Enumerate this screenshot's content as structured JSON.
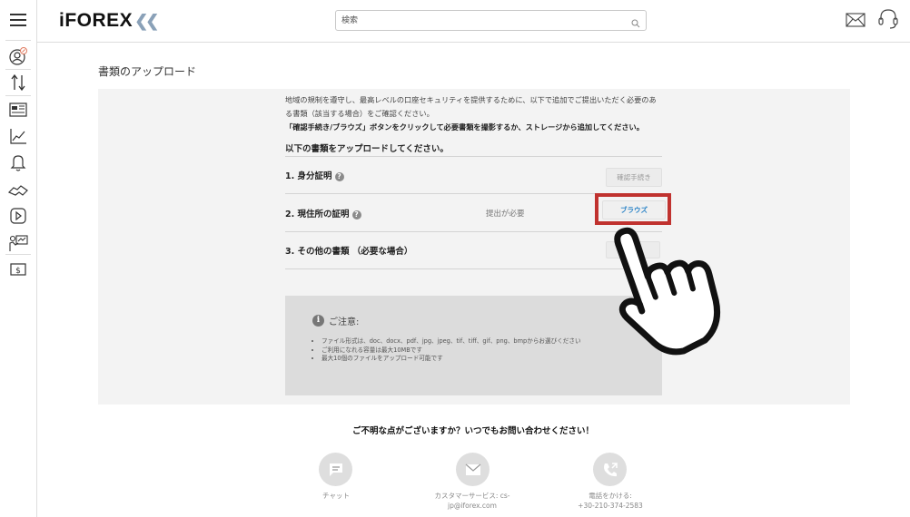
{
  "header": {
    "logo_text": "iFOREX",
    "logo_suffix": "❮❮",
    "search_placeholder": "検索"
  },
  "page": {
    "title": "書類のアップロード",
    "intro_line1": "地域の規制を遵守し、最高レベルの口座セキュリティを提供するために、以下で追加でご提出いただく必要のあ",
    "intro_line2": "る書類（該当する場合）をご確認ください。",
    "intro_line3": "「確認手続き/ブラウズ」ボタンをクリックして必要書類を撮影するか、ストレージから追加してください。",
    "upload_heading": "以下の書類をアップロードしてください。"
  },
  "documents": [
    {
      "label": "1.  身分証明",
      "status": "",
      "button": "確認手続き"
    },
    {
      "label": "2.  現住所の証明",
      "status": "提出が必要",
      "button": "ブラウズ"
    },
    {
      "label": "3.  その他の書類 （必要な場合）",
      "status": "",
      "button": "ブ"
    }
  ],
  "note": {
    "heading": "ご注意:",
    "items": [
      "ファイル形式は、doc、docx、pdf、jpg、jpeg、tif、tiff、gif、png、bmpからお選びください",
      "ご利用になれる容量は最大10MBです",
      "最大10個のファイルをアップロード可能です"
    ]
  },
  "contact": {
    "heading": "ご不明な点がございますか？いつでもお問い合わせください！",
    "chat_label": "チャット",
    "email_label_1": "カスタマーサービス: cs-",
    "email_label_2": "jp@iforex.com",
    "phone_label_1": "電話をかける:",
    "phone_label_2": "+30-210-374-2583"
  },
  "colors": {
    "accent_red": "#c0322f",
    "link_blue": "#2a83c7"
  },
  "icons": [
    "menu-icon",
    "user-icon",
    "transfer-icon",
    "news-icon",
    "chart-icon",
    "bell-icon",
    "handshake-icon",
    "play-icon",
    "education-icon",
    "dollar-icon",
    "search-icon",
    "mail-icon",
    "headset-icon",
    "help-icon",
    "info-icon",
    "chat-icon",
    "email-icon",
    "phone-icon",
    "pointing-hand-icon"
  ]
}
